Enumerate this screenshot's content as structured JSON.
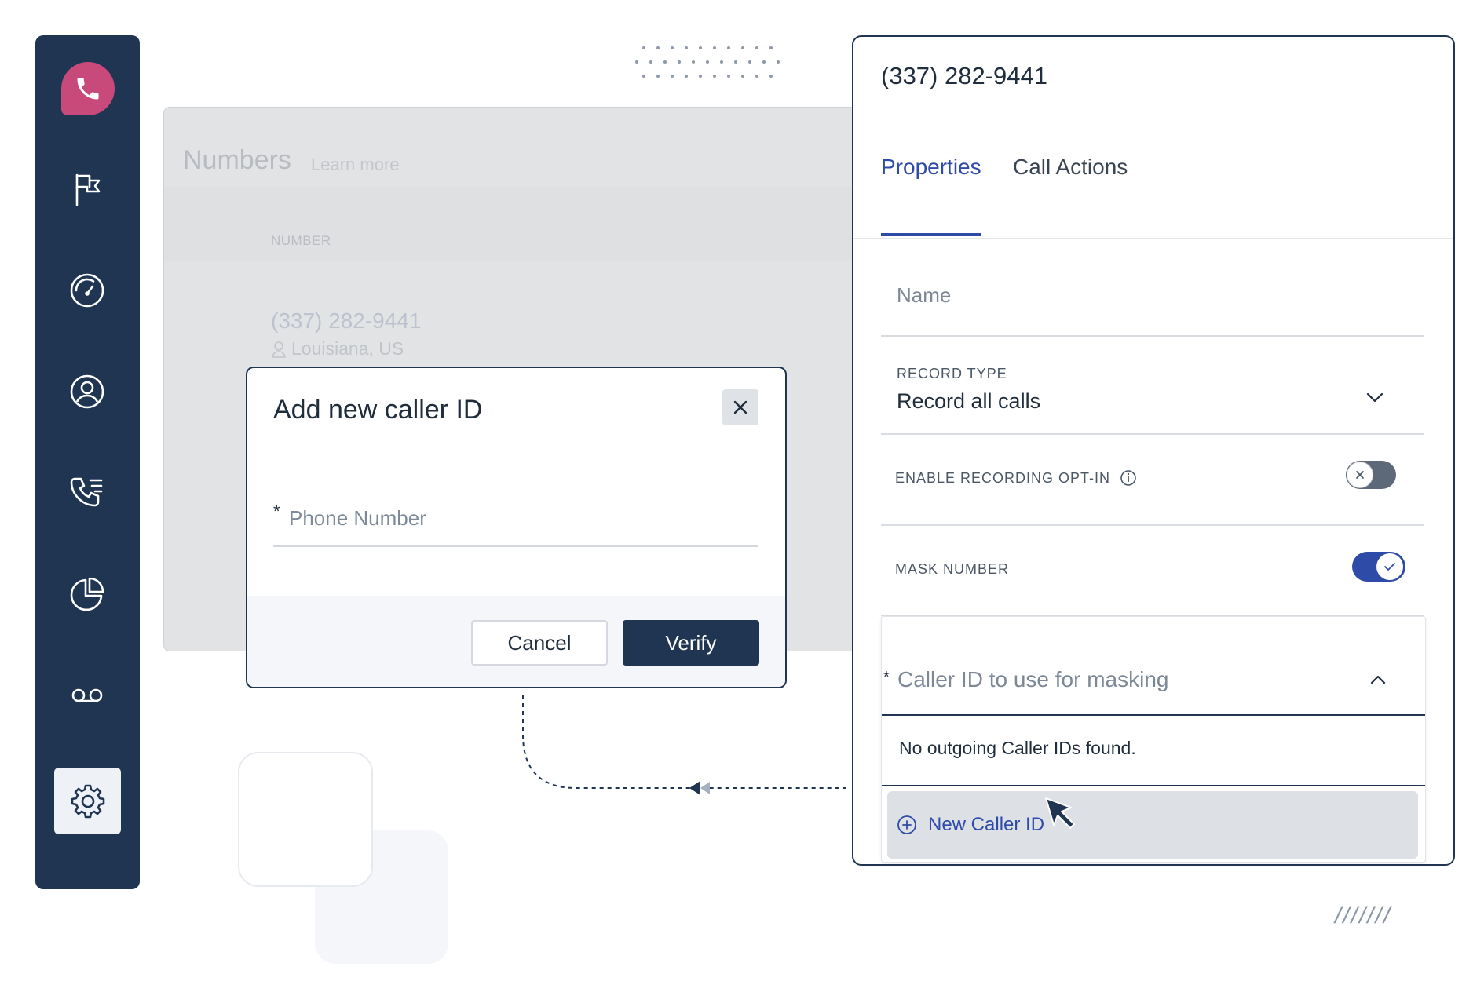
{
  "sidebar": {
    "items": [
      {
        "icon": "phone-icon"
      },
      {
        "icon": "flag-icon"
      },
      {
        "icon": "gauge-icon"
      },
      {
        "icon": "user-circle-icon"
      },
      {
        "icon": "call-list-icon"
      },
      {
        "icon": "pie-chart-icon"
      },
      {
        "icon": "voicemail-icon"
      },
      {
        "icon": "gear-icon",
        "active": true
      }
    ],
    "colors": {
      "background": "#1f3552",
      "logo": "#c74a7a",
      "active_bg": "#eef2f7"
    }
  },
  "numbers_panel": {
    "title": "Numbers",
    "learn_more": "Learn more",
    "column_header": "NUMBER",
    "row": {
      "number": "(337) 282-9441",
      "location": "Louisiana, US"
    }
  },
  "modal": {
    "title": "Add new caller ID",
    "field_required_mark": "*",
    "phone_placeholder": "Phone Number",
    "cancel_label": "Cancel",
    "verify_label": "Verify"
  },
  "right_panel": {
    "title": "(337) 282-9441",
    "tabs": [
      {
        "label": "Properties",
        "active": true
      },
      {
        "label": "Call Actions",
        "active": false
      }
    ],
    "name_placeholder": "Name",
    "record_type": {
      "label": "RECORD TYPE",
      "value": "Record all calls"
    },
    "recording_opt_in": {
      "label": "ENABLE RECORDING OPT-IN",
      "enabled": false
    },
    "mask_number": {
      "label": "MASK NUMBER",
      "enabled": true
    },
    "caller_id_dropdown": {
      "required_mark": "*",
      "placeholder": "Caller ID to use for masking",
      "empty_message": "No outgoing Caller IDs found.",
      "new_option": "New Caller ID"
    }
  },
  "decor": {
    "slashes": "///////"
  },
  "colors": {
    "accent": "#2f4ba8",
    "navy": "#1f3552"
  }
}
